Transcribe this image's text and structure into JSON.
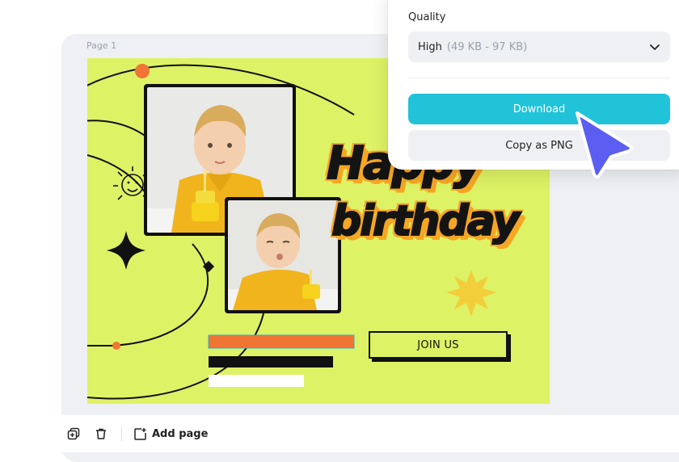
{
  "editor": {
    "page_label": "Page 1"
  },
  "design": {
    "headline_line1": "Happy",
    "headline_line2": "birthday",
    "cta_label": "JOIN US",
    "colors": {
      "background": "#def265",
      "accent_orange": "#f07535",
      "text_outline": "#f5a623",
      "sun_yellow": "#f2cf3a"
    }
  },
  "toolbar": {
    "duplicate_icon": "duplicate-icon",
    "delete_icon": "trash-icon",
    "add_page_icon": "add-page-icon",
    "add_page_label": "Add page"
  },
  "export_popup": {
    "quality_label": "Quality",
    "quality_value": "High",
    "quality_range": "(49 KB - 97 KB)",
    "download_label": "Download",
    "copy_label": "Copy as PNG",
    "accent": "#21c3d9"
  },
  "cursor": {
    "color": "#5b5ef0"
  }
}
